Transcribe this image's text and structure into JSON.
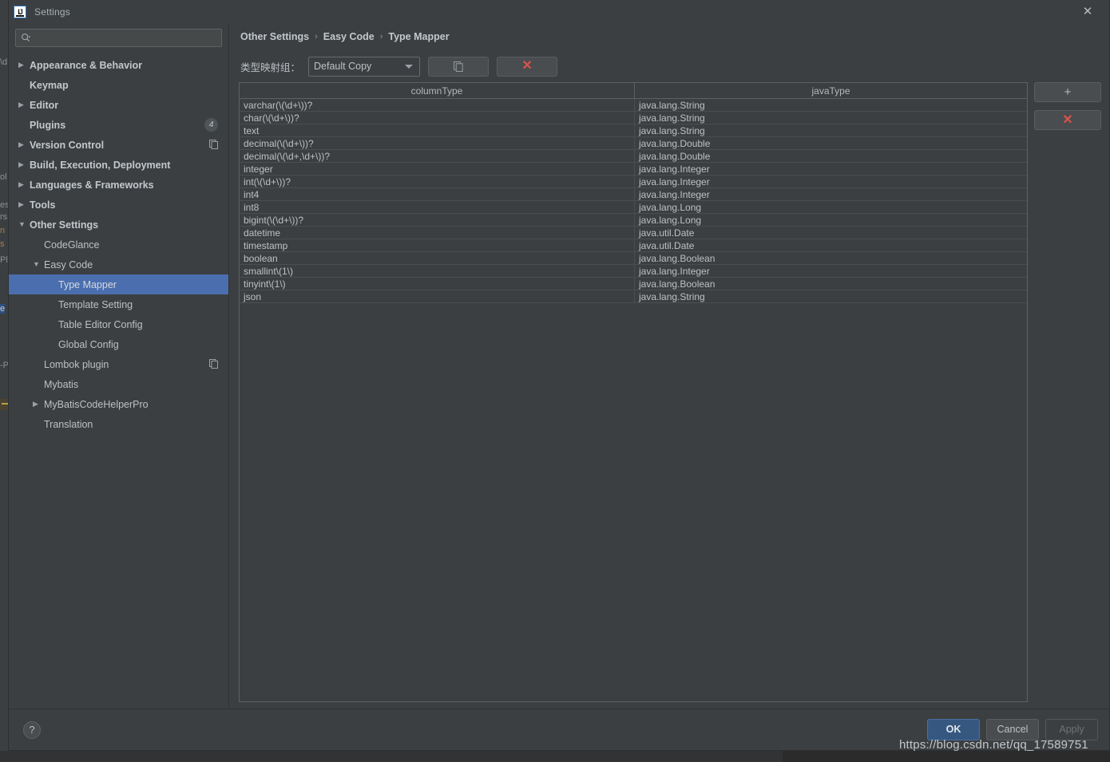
{
  "window": {
    "title": "Settings",
    "logo_alt": "IJ",
    "close_label": "✕"
  },
  "search": {
    "value": "",
    "placeholder": ""
  },
  "sidebar": {
    "items": [
      {
        "label": "Appearance & Behavior",
        "level": 0,
        "arrow": "▶",
        "bold": true,
        "selected": false
      },
      {
        "label": "Keymap",
        "level": 0,
        "arrow": "",
        "bold": true,
        "selected": false
      },
      {
        "label": "Editor",
        "level": 0,
        "arrow": "▶",
        "bold": true,
        "selected": false
      },
      {
        "label": "Plugins",
        "level": 0,
        "arrow": "",
        "bold": true,
        "selected": false,
        "badge": "4"
      },
      {
        "label": "Version Control",
        "level": 0,
        "arrow": "▶",
        "bold": true,
        "selected": false,
        "copy_icon": true
      },
      {
        "label": "Build, Execution, Deployment",
        "level": 0,
        "arrow": "▶",
        "bold": true,
        "selected": false
      },
      {
        "label": "Languages & Frameworks",
        "level": 0,
        "arrow": "▶",
        "bold": true,
        "selected": false
      },
      {
        "label": "Tools",
        "level": 0,
        "arrow": "▶",
        "bold": true,
        "selected": false
      },
      {
        "label": "Other Settings",
        "level": 0,
        "arrow": "▼",
        "bold": true,
        "selected": false
      },
      {
        "label": "CodeGlance",
        "level": 1,
        "arrow": "",
        "bold": false,
        "selected": false
      },
      {
        "label": "Easy Code",
        "level": 1,
        "arrow": "▼",
        "bold": false,
        "selected": false
      },
      {
        "label": "Type Mapper",
        "level": 2,
        "arrow": "",
        "bold": false,
        "selected": true
      },
      {
        "label": "Template Setting",
        "level": 2,
        "arrow": "",
        "bold": false,
        "selected": false
      },
      {
        "label": "Table Editor Config",
        "level": 2,
        "arrow": "",
        "bold": false,
        "selected": false
      },
      {
        "label": "Global Config",
        "level": 2,
        "arrow": "",
        "bold": false,
        "selected": false
      },
      {
        "label": "Lombok plugin",
        "level": 1,
        "arrow": "",
        "bold": false,
        "selected": false,
        "copy_icon": true
      },
      {
        "label": "Mybatis",
        "level": 1,
        "arrow": "",
        "bold": false,
        "selected": false
      },
      {
        "label": "MyBatisCodeHelperPro",
        "level": 1,
        "arrow": "▶",
        "bold": false,
        "selected": false
      },
      {
        "label": "Translation",
        "level": 1,
        "arrow": "",
        "bold": false,
        "selected": false
      }
    ]
  },
  "breadcrumb": {
    "items": [
      "Other Settings",
      "Easy Code",
      "Type Mapper"
    ],
    "separator": "›"
  },
  "toolbar": {
    "group_label": "类型映射组：",
    "group_value": "Default Copy",
    "group_options": [
      "Default Copy"
    ],
    "copy_button_label": "",
    "delete_button_label": "✕"
  },
  "side_buttons": {
    "add_label": "+",
    "remove_label": "✕"
  },
  "table": {
    "columns": [
      "columnType",
      "javaType"
    ],
    "rows": [
      [
        "varchar(\\(\\d+\\))?",
        "java.lang.String"
      ],
      [
        "char(\\(\\d+\\))?",
        "java.lang.String"
      ],
      [
        "text",
        "java.lang.String"
      ],
      [
        "decimal(\\(\\d+\\))?",
        "java.lang.Double"
      ],
      [
        "decimal(\\(\\d+,\\d+\\))?",
        "java.lang.Double"
      ],
      [
        "integer",
        "java.lang.Integer"
      ],
      [
        "int(\\(\\d+\\))?",
        "java.lang.Integer"
      ],
      [
        "int4",
        "java.lang.Integer"
      ],
      [
        "int8",
        "java.lang.Long"
      ],
      [
        "bigint(\\(\\d+\\))?",
        "java.lang.Long"
      ],
      [
        "datetime",
        "java.util.Date"
      ],
      [
        "timestamp",
        "java.util.Date"
      ],
      [
        "boolean",
        "java.lang.Boolean"
      ],
      [
        "smallint\\(1\\)",
        "java.lang.Integer"
      ],
      [
        "tinyint\\(1\\)",
        "java.lang.Boolean"
      ],
      [
        "json",
        "java.lang.String"
      ]
    ]
  },
  "footer": {
    "help_label": "?",
    "ok_label": "OK",
    "cancel_label": "Cancel",
    "apply_label": "Apply"
  },
  "watermark": {
    "text": "https://blog.csdn.net/qq_17589751"
  },
  "background_fragments": {
    "left": [
      "\\d",
      "ol",
      "es",
      "rs",
      "n",
      "s",
      "Pl",
      "e",
      "-P"
    ],
    "right": [
      "✕",
      "✕"
    ]
  },
  "colors": {
    "panel": "#3c3f41",
    "selection": "#4b6eaf",
    "accent_ok": "#365880",
    "danger": "#d9534f",
    "text": "#bcc1c5"
  }
}
